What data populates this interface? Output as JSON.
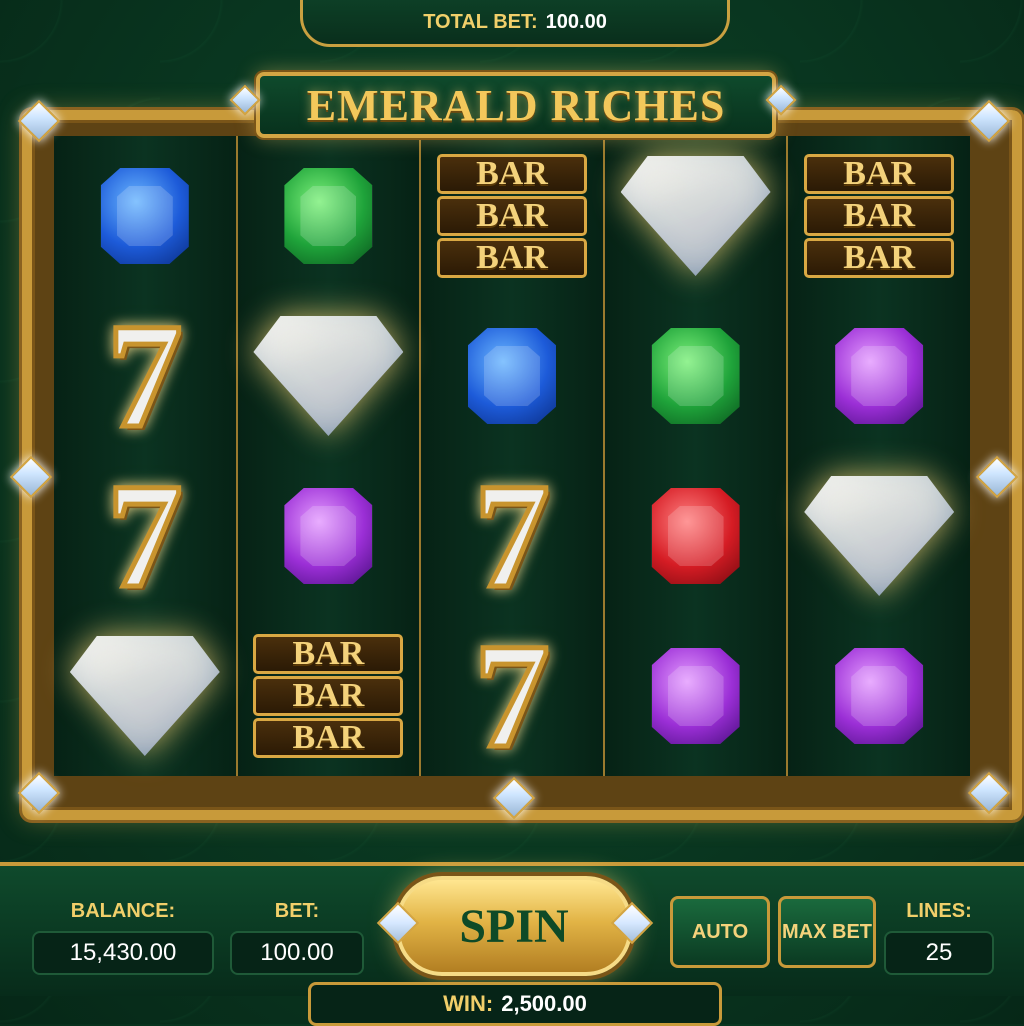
{
  "header": {
    "total_bet_label": "TOTAL BET:",
    "total_bet_value": "100.00"
  },
  "title": "EMERALD RICHES",
  "reels": [
    [
      "gem-blue",
      "seven",
      "seven",
      "diamond"
    ],
    [
      "gem-green",
      "diamond",
      "gem-purple",
      "bar"
    ],
    [
      "bar",
      "gem-blue",
      "seven",
      "seven"
    ],
    [
      "diamond",
      "gem-green",
      "gem-red",
      "gem-purple"
    ],
    [
      "bar",
      "gem-purple",
      "diamond",
      "gem-purple"
    ]
  ],
  "symbol_text": {
    "bar": "BAR",
    "seven": "7"
  },
  "footer": {
    "balance_label": "BALANCE:",
    "balance_value": "15,430.00",
    "bet_label": "BET:",
    "bet_value": "100.00",
    "spin_label": "SPIN",
    "auto_label": "AUTO",
    "max_bet_label": "MAX BET",
    "lines_label": "LINES:",
    "lines_value": "25",
    "win_label": "WIN:",
    "win_value": "2,500.00"
  },
  "colors": {
    "gold": "#c89a3a",
    "felt": "#0a3a22",
    "title_gold": "#f3c85b"
  }
}
